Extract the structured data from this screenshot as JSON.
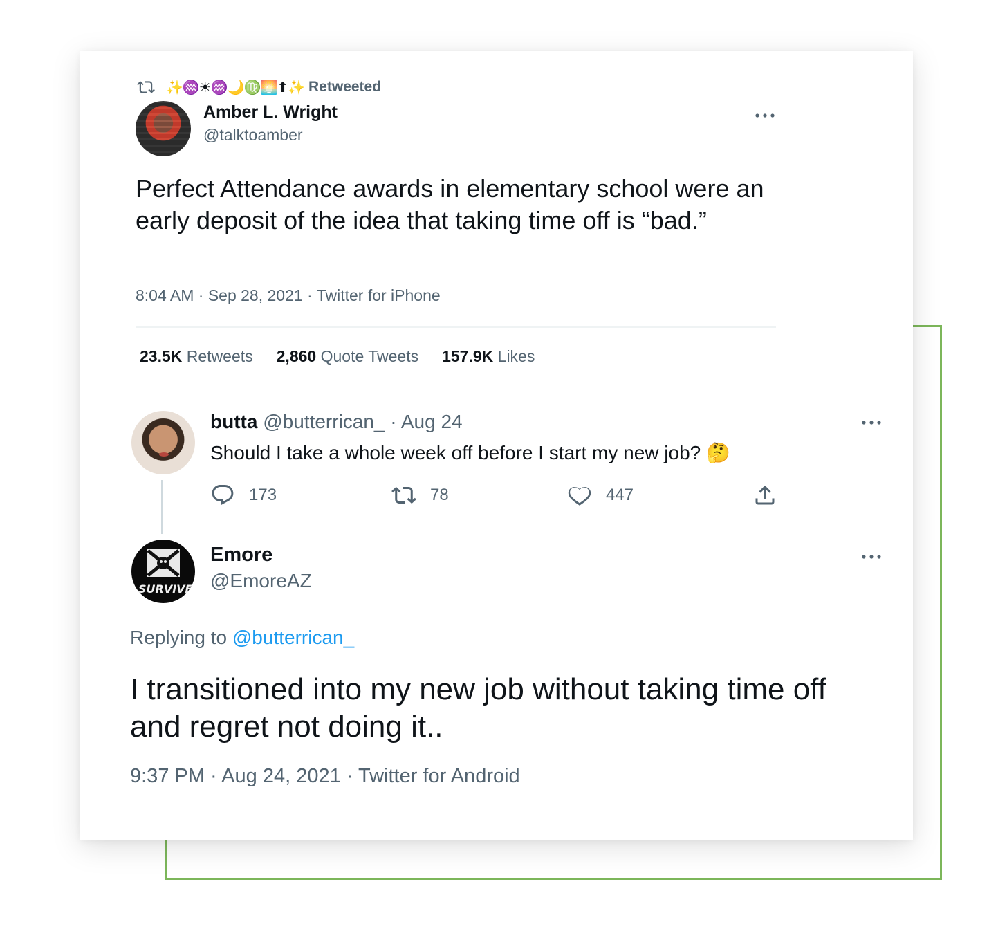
{
  "retweet_bar": {
    "emoji_name": "✨♒☀♒🌙♍🌅⬆✨",
    "label": "Retweeted"
  },
  "main_tweet": {
    "author_name": "Amber L. Wright",
    "author_handle": "@talktoamber",
    "text": "Perfect Attendance awards in elementary school were an early deposit of the idea that taking time off is “bad.”",
    "meta": "8:04 AM · Sep 28, 2021 · Twitter for iPhone",
    "stats": [
      {
        "value": "23.5K",
        "label": "Retweets"
      },
      {
        "value": "2,860",
        "label": "Quote Tweets"
      },
      {
        "value": "157.9K",
        "label": "Likes"
      }
    ]
  },
  "quoted_parent": {
    "author_name": "butta",
    "author_handle_date": "@butterrican_ · Aug 24",
    "text": "Should I take a whole week off before I start my new job? 🤔",
    "actions": {
      "replies": "173",
      "retweets": "78",
      "likes": "447"
    }
  },
  "reply_tweet": {
    "author_name": "Emore",
    "author_handle": "@EmoreAZ",
    "avatar_text": "SURVIVE",
    "replying_prefix": "Replying to",
    "replying_handle": "@butterrican_",
    "text": "I transitioned into my new job without taking time off and regret not doing it..",
    "meta": "9:37 PM · Aug 24, 2021 · Twitter for Android"
  },
  "colors": {
    "text_primary": "#0f1419",
    "text_secondary": "#536471",
    "link": "#1d9bf0",
    "frame_accent": "#7cb65a"
  }
}
